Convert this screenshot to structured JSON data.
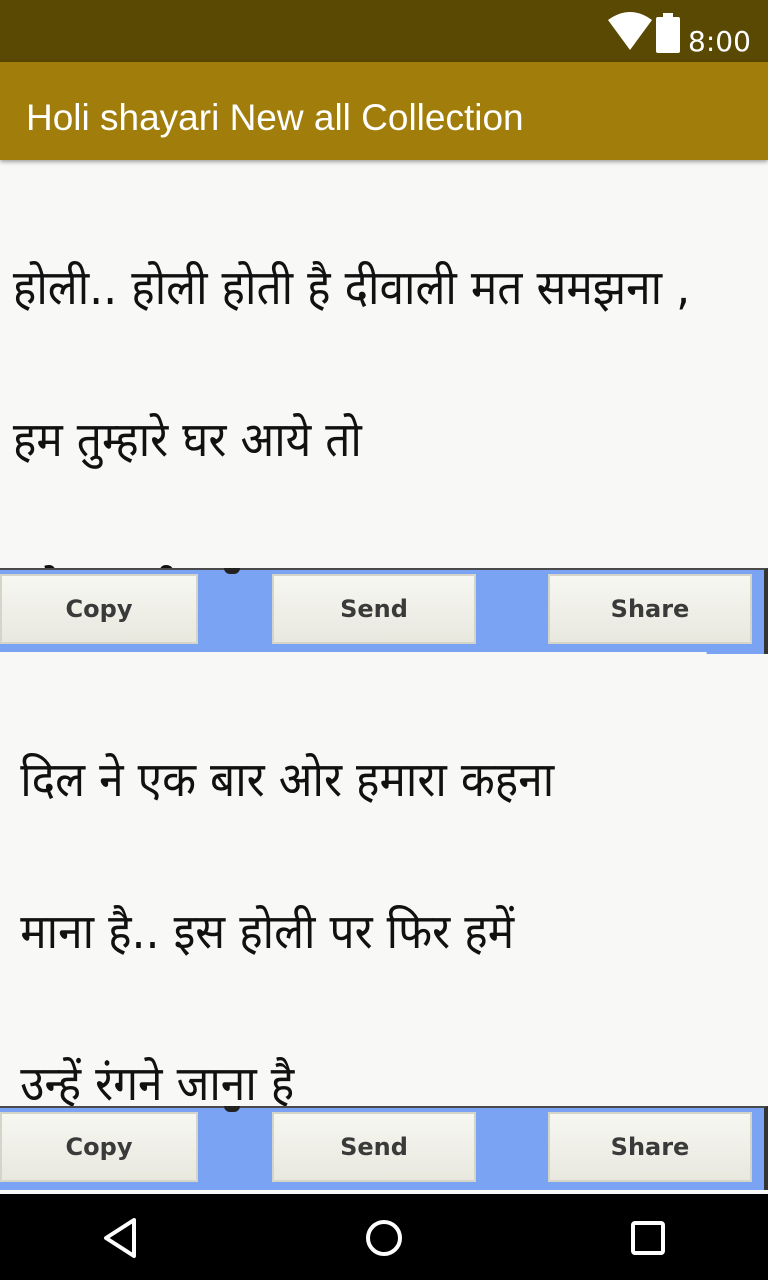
{
  "status_bar": {
    "time": "8:00",
    "wifi_icon": "wifi-icon",
    "battery_icon": "battery-icon"
  },
  "app_bar": {
    "title": "Holi shayari New all Collection"
  },
  "cards": [
    {
      "lines": [
        "होली.. होली होती है दीवाली मत समझना ,",
        " हम तुम्हारे घर आये तो",
        " हमे मवाली मत समझना Happy Holi"
      ],
      "buttons": {
        "copy": "Copy",
        "send": "Send",
        "share": "Share"
      }
    },
    {
      "lines": [
        "दिल ने एक बार ओर हमारा कहना",
        "माना है.. इस होली पर फिर हमें",
        "उन्हें रंगने जाना है"
      ],
      "buttons": {
        "copy": "Copy",
        "send": "Send",
        "share": "Share"
      }
    }
  ],
  "nav_bar": {
    "icons": [
      "back-icon",
      "home-icon",
      "recents-icon"
    ]
  },
  "colors": {
    "status_bar": "#5a4903",
    "app_bar": "#a17e0c",
    "button_row": "#7aa3f4",
    "nav_bar": "#000000"
  }
}
